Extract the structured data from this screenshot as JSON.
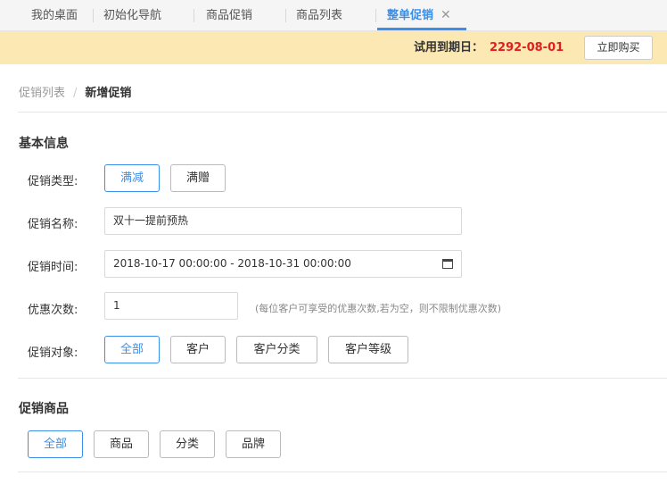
{
  "tabs": [
    {
      "label": "我的桌面"
    },
    {
      "label": "初始化导航"
    },
    {
      "label": "商品促销"
    },
    {
      "label": "商品列表"
    },
    {
      "label": "整单促销"
    }
  ],
  "tab_close_symbol": "✕",
  "banner": {
    "trial_label": "试用到期日：",
    "trial_date": "2292-08-01",
    "buy_label": "立即购买"
  },
  "breadcrumb": {
    "parent": "促销列表",
    "separator": "/",
    "current": "新增促销"
  },
  "basic_info": {
    "title": "基本信息",
    "type_label": "促销类型:",
    "type_options": [
      "满减",
      "满赠"
    ],
    "type_selected": "满减",
    "name_label": "促销名称:",
    "name_value": "双十一提前预热",
    "time_label": "促销时间:",
    "time_value": "2018-10-17 00:00:00 - 2018-10-31 00:00:00",
    "count_label": "优惠次数:",
    "count_value": "1",
    "count_hint": "(每位客户可享受的优惠次数,若为空，则不限制优惠次数)",
    "target_label": "促销对象:",
    "target_options": [
      "全部",
      "客户",
      "客户分类",
      "客户等级"
    ],
    "target_selected": "全部"
  },
  "products": {
    "title": "促销商品",
    "options": [
      "全部",
      "商品",
      "分类",
      "品牌"
    ],
    "selected": "全部"
  },
  "colors": {
    "accent": "#3b8fe8",
    "banner_bg": "#fce8b2",
    "trial_date": "#e02020"
  },
  "icons": {
    "calendar": "calendar-icon",
    "close": "close-icon"
  }
}
